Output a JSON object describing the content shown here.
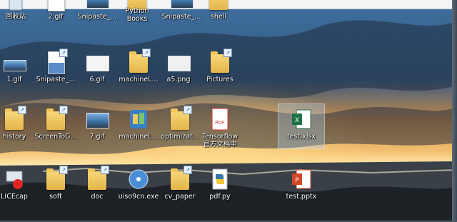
{
  "desktop": {
    "icons": [
      {
        "label": "回收站",
        "kind": "recycle"
      },
      {
        "label": "2.gif",
        "kind": "image"
      },
      {
        "label": "Snipaste_...",
        "kind": "image"
      },
      {
        "label": "Python Books",
        "kind": "folder"
      },
      {
        "label": "Snipaste_...",
        "kind": "image"
      },
      {
        "label": "shell",
        "kind": "folder"
      },
      {
        "label": "1.gif",
        "kind": "image"
      },
      {
        "label": "Snipaste_...",
        "kind": "image"
      },
      {
        "label": "6.gif",
        "kind": "image"
      },
      {
        "label": "machineL...",
        "kind": "folder"
      },
      {
        "label": "a5.png",
        "kind": "image"
      },
      {
        "label": "Pictures",
        "kind": "folder"
      },
      {
        "label": "history",
        "kind": "folder"
      },
      {
        "label": "ScreenToG...",
        "kind": "folder"
      },
      {
        "label": "7.gif",
        "kind": "image"
      },
      {
        "label": "machineL...",
        "kind": "app"
      },
      {
        "label": "optimizat...",
        "kind": "folder"
      },
      {
        "label": "Tensorflow 官方文档中",
        "kind": "pdf"
      },
      {
        "label": "test.xlsx",
        "kind": "excel"
      },
      {
        "label": "LICEcap",
        "kind": "licecap"
      },
      {
        "label": "soft",
        "kind": "folder"
      },
      {
        "label": "doc",
        "kind": "folder"
      },
      {
        "label": "uiso9cn.exe",
        "kind": "disc"
      },
      {
        "label": "cv_paper",
        "kind": "folder"
      },
      {
        "label": "pdf.py",
        "kind": "python"
      },
      {
        "label": "test.pptx",
        "kind": "ppt"
      }
    ]
  },
  "colors": {
    "folder": "#e9bd55",
    "excel": "#1f7244",
    "ppt": "#d24726",
    "pdf": "#d0342c"
  }
}
